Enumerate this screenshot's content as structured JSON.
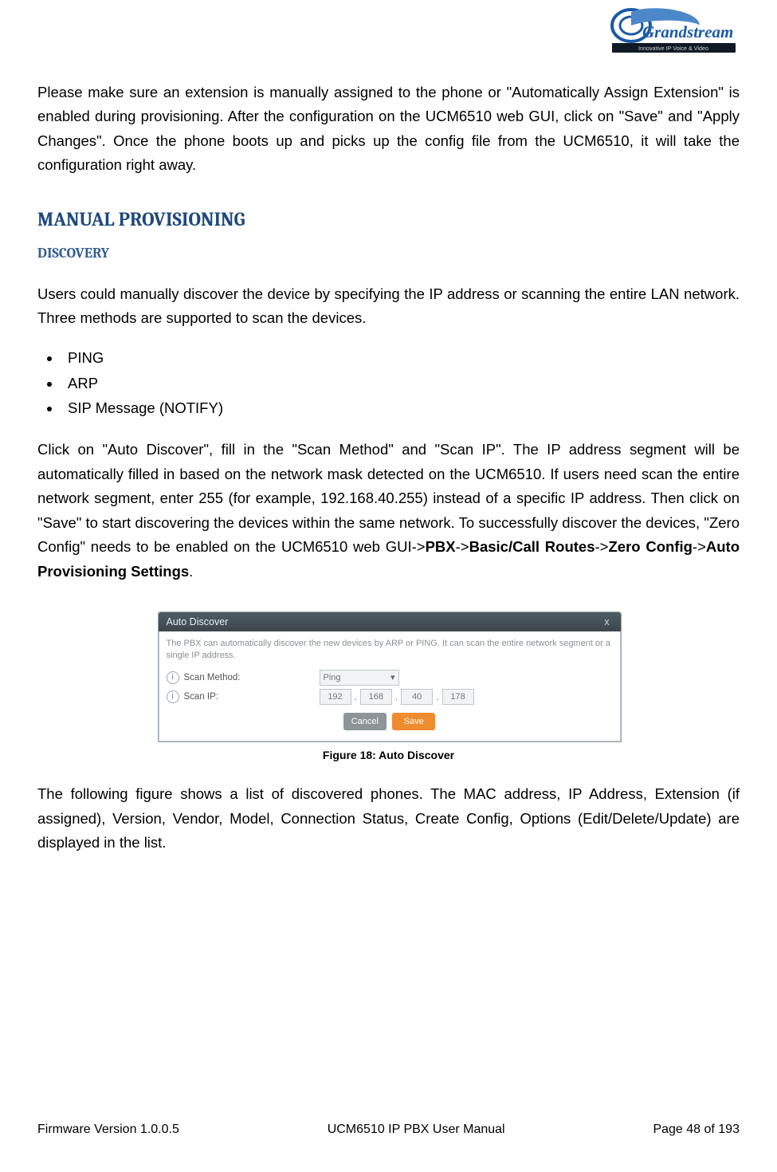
{
  "header": {
    "logo_main": "Grandstream",
    "logo_tag": "Innovative IP Voice & Video"
  },
  "content": {
    "intro_para": "Please make sure an extension is manually assigned to the phone or \"Automatically Assign Extension\" is enabled during provisioning. After the configuration on the UCM6510 web GUI, click on \"Save\" and \"Apply Changes\". Once the phone boots up and picks up the config file from the UCM6510, it will take the configuration right away.",
    "h2": "MANUAL PROVISIONING",
    "h3": "DISCOVERY",
    "discovery_para": "Users could manually discover the device by specifying the IP address or scanning the entire LAN network. Three methods are supported to scan the devices.",
    "methods": [
      "PING",
      "ARP",
      "SIP Message (NOTIFY)"
    ],
    "click_para": {
      "p1": "Click on \"Auto Discover\", fill in the \"Scan Method\" and \"Scan IP\". The IP address segment will be automatically filled in based on the network mask detected on the UCM6510. If users need scan the entire network segment, enter 255 (for example, 192.168.40.255) instead of a specific IP address. Then click on \"Save\" to start discovering the devices within the same network. To successfully discover the devices, \"Zero Config\" needs to be enabled on the UCM6510 web GUI->",
      "b1": "PBX",
      "s2": "->",
      "b2": "Basic/Call Routes",
      "s3": "->",
      "b3": "Zero Config",
      "s4": "->",
      "b4": "Auto Provisioning Settings",
      "s5": "."
    },
    "figure_caption": "Figure 18: Auto Discover",
    "following_para": "The following figure shows a list of discovered phones. The MAC address, IP Address, Extension (if assigned), Version, Vendor, Model, Connection Status, Create Config, Options (Edit/Delete/Update) are displayed in the list."
  },
  "auto_discover": {
    "title": "Auto Discover",
    "close": "x",
    "hint": "The PBX can automatically discover the new devices by ARP or PING. It can scan the entire network segment or a single IP address.",
    "scan_method_label": "Scan Method:",
    "scan_method_value": "Ping",
    "scan_ip_label": "Scan IP:",
    "ip": [
      "192",
      "168",
      "40",
      "178"
    ],
    "cancel": "Cancel",
    "save": "Save"
  },
  "footer": {
    "left": "Firmware Version 1.0.0.5",
    "center": "UCM6510 IP PBX User Manual",
    "right": "Page 48 of 193"
  }
}
